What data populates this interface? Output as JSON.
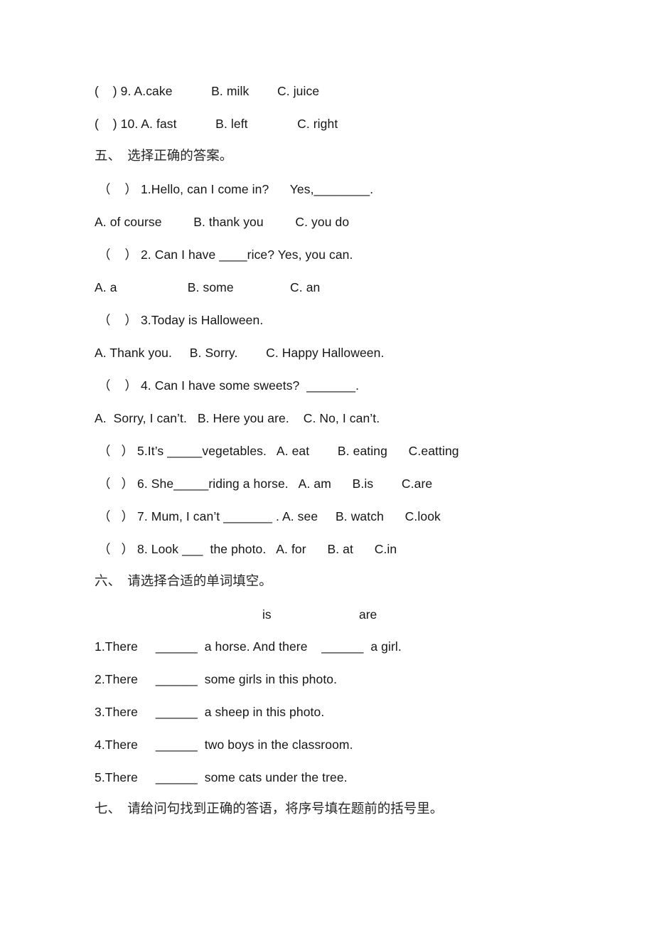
{
  "document": {
    "type": "worksheet-page",
    "language": "en-zh",
    "background_color": "#ffffff",
    "text_color": "#161616"
  },
  "listening_tail": {
    "items": [
      {
        "bracket": "(    )",
        "number": "9.",
        "a": "A.cake",
        "b": "B. milk",
        "c": "C. juice",
        "line": "(    ) 9. A.cake           B. milk        C. juice"
      },
      {
        "bracket": "(    )",
        "number": "10.",
        "a": "A. fast",
        "b": "B. left",
        "c": "C. right",
        "line": "(    ) 10. A. fast           B. left              C. right"
      }
    ]
  },
  "section_five": {
    "number": "五、",
    "title": "选择正确的答案。",
    "heading": "五、  选择正确的答案。",
    "questions": [
      {
        "bracket": "（    ）",
        "number": "1.",
        "stem": "Hello, can I come in?",
        "tail": "Yes,________.",
        "line": " （    ） 1.Hello, can I come in?      Yes,________.",
        "options_line": "A. of course         B. thank you         C. you do",
        "options": [
          "A. of course",
          "B. thank you",
          "C. you do"
        ]
      },
      {
        "bracket": "（    ）",
        "number": "2.",
        "stem": "Can I have ____rice? Yes, you can.",
        "line": " （    ） 2. Can I have ____rice? Yes, you can.",
        "options_line": "A. a                    B. some                C. an",
        "options": [
          "A. a",
          "B. some",
          "C. an"
        ]
      },
      {
        "bracket": "（    ）",
        "number": "3.",
        "stem": "Today is Halloween.",
        "line": " （    ） 3.Today is Halloween.",
        "options_line": "A. Thank you.     B. Sorry.        C. Happy Halloween.",
        "options": [
          "A. Thank you.",
          "B. Sorry.",
          "C. Happy Halloween."
        ]
      },
      {
        "bracket": "（    ）",
        "number": "4.",
        "stem": "Can I have some sweets?  _______.",
        "line": " （    ） 4. Can I have some sweets?  _______.",
        "options_line": "A.  Sorry, I can’t.   B. Here you are.    C. No, I can’t.",
        "options": [
          "A.  Sorry, I can’t.",
          "B. Here you are.",
          "C. No, I can’t."
        ]
      },
      {
        "bracket": "（    ）",
        "number": "5.",
        "stem": "It’s _____vegetables.",
        "line": " （   ） 5.It’s _____vegetables.   A. eat        B. eating      C.eatting",
        "options": [
          "A. eat",
          "B. eating",
          "C.eatting"
        ]
      },
      {
        "bracket": "（    ）",
        "number": "6.",
        "stem": "She_____riding a horse.",
        "line": " （   ） 6. She_____riding a horse.   A. am      B.is        C.are",
        "options": [
          "A. am",
          "B.is",
          "C.are"
        ]
      },
      {
        "bracket": "（    ）",
        "number": "7.",
        "stem": "Mum, I can’t _______ .",
        "line": " （   ） 7. Mum, I can’t _______ . A. see     B. watch      C.look",
        "options": [
          "A. see",
          "B. watch",
          "C.look"
        ]
      },
      {
        "bracket": "（    ）",
        "number": "8.",
        "stem": "Look ___ the photo.",
        "line": " （   ） 8. Look ___  the photo.   A. for      B. at      C.in",
        "options": [
          "A. for",
          "B. at",
          "C.in"
        ]
      }
    ]
  },
  "section_six": {
    "number": "六、",
    "title": "请选择合适的单词填空。",
    "heading": "六、  请选择合适的单词填空。",
    "word_bank": [
      "is",
      "are"
    ],
    "items": [
      {
        "number": "1.",
        "line": "1.There     ______  a horse. And there    ______  a girl."
      },
      {
        "number": "2.",
        "line": "2.There     ______  some girls in this photo."
      },
      {
        "number": "3.",
        "line": "3.There     ______  a sheep in this photo."
      },
      {
        "number": "4.",
        "line": "4.There     ______  two boys in the classroom."
      },
      {
        "number": "5.",
        "line": "5.There     ______  some cats under the tree."
      }
    ]
  },
  "section_seven": {
    "number": "七、",
    "title": "请给问句找到正确的答语，将序号填在题前的括号里。",
    "heading": "七、  请给问句找到正确的答语，将序号填在题前的括号里。"
  }
}
